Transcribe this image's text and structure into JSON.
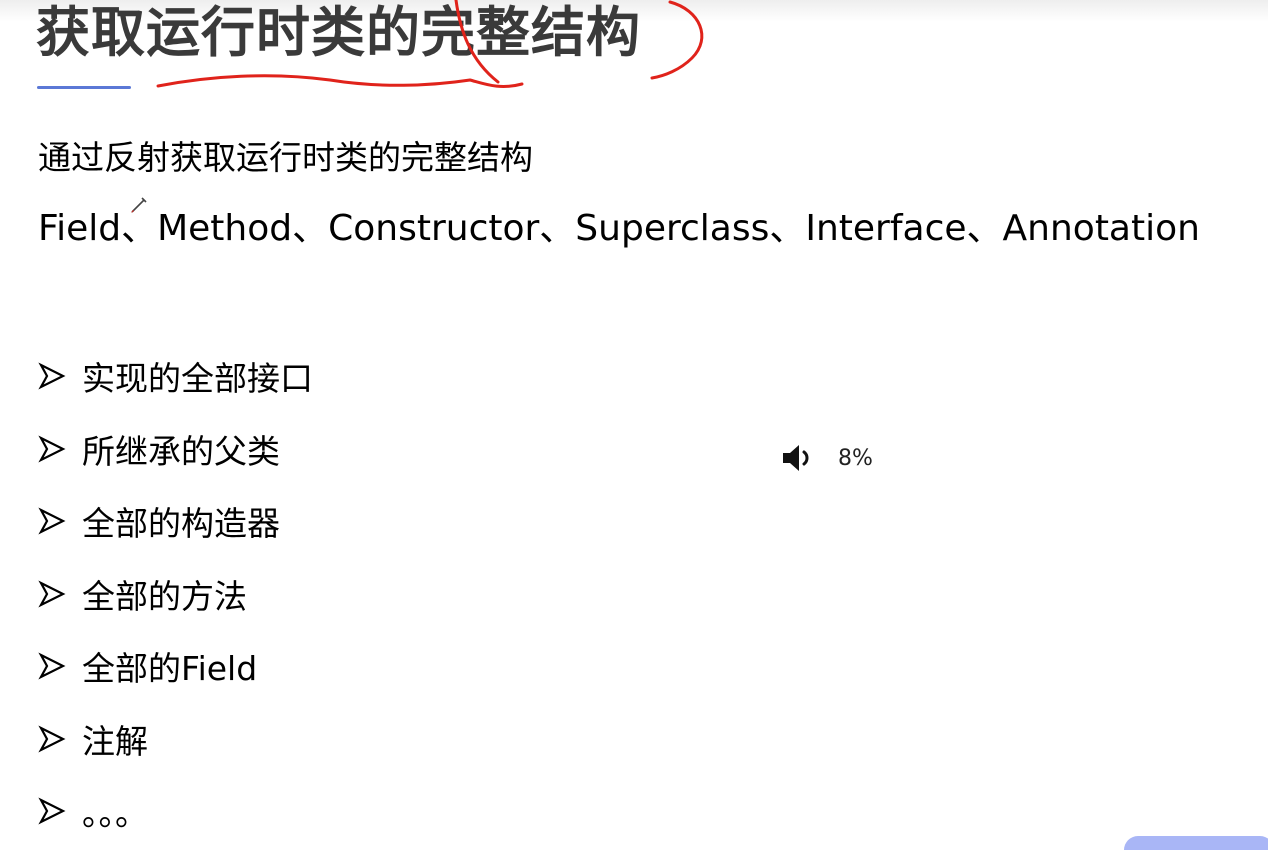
{
  "slide": {
    "title": "获取运行时类的完整结构",
    "intro": "通过反射获取运行时类的完整结构",
    "members": "Field、Method、Constructor、Superclass、Interface、Annotation",
    "items": [
      {
        "label": "实现的全部接口"
      },
      {
        "label": "所继承的父类"
      },
      {
        "label": "全部的构造器"
      },
      {
        "label": "全部的方法"
      },
      {
        "label": "全部的Field"
      },
      {
        "label": "注解"
      },
      {
        "label": "。。。"
      }
    ]
  },
  "overlay": {
    "volume_icon": "speaker-icon",
    "volume_level": "8%"
  },
  "colors": {
    "title": "#3a3a3a",
    "title_underline": "#5b78d6",
    "annotation": "#e0231b",
    "corner_tab": "#a9b6f6"
  }
}
